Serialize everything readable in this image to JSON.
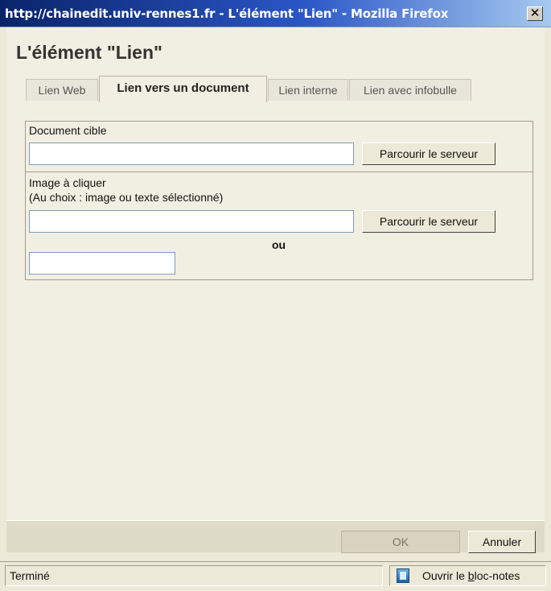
{
  "window": {
    "title": "http://chainedit.univ-rennes1.fr - L'élément \"Lien\" - Mozilla Firefox",
    "close_glyph": "✕"
  },
  "dialog": {
    "heading": "L'élément \"Lien\"",
    "tabs": [
      {
        "label": "Lien Web",
        "active": false
      },
      {
        "label": "Lien vers un document",
        "active": true
      },
      {
        "label": "Lien interne",
        "active": false
      },
      {
        "label": "Lien avec infobulle",
        "active": false
      }
    ],
    "document_cible": {
      "label": "Document cible",
      "value": "",
      "browse_label": "Parcourir le serveur"
    },
    "image": {
      "label_line1": "Image à cliquer",
      "label_line2": "(Au choix : image ou texte sélectionné)",
      "value": "",
      "browse_label": "Parcourir le serveur",
      "or_label": "ou",
      "text_value": ""
    },
    "footer": {
      "ok_label": "OK",
      "cancel_label": "Annuler"
    }
  },
  "statusbar": {
    "status": "Terminé",
    "notepad_prefix": "Ouvrir le ",
    "notepad_underlined": "b",
    "notepad_suffix": "loc-notes"
  }
}
